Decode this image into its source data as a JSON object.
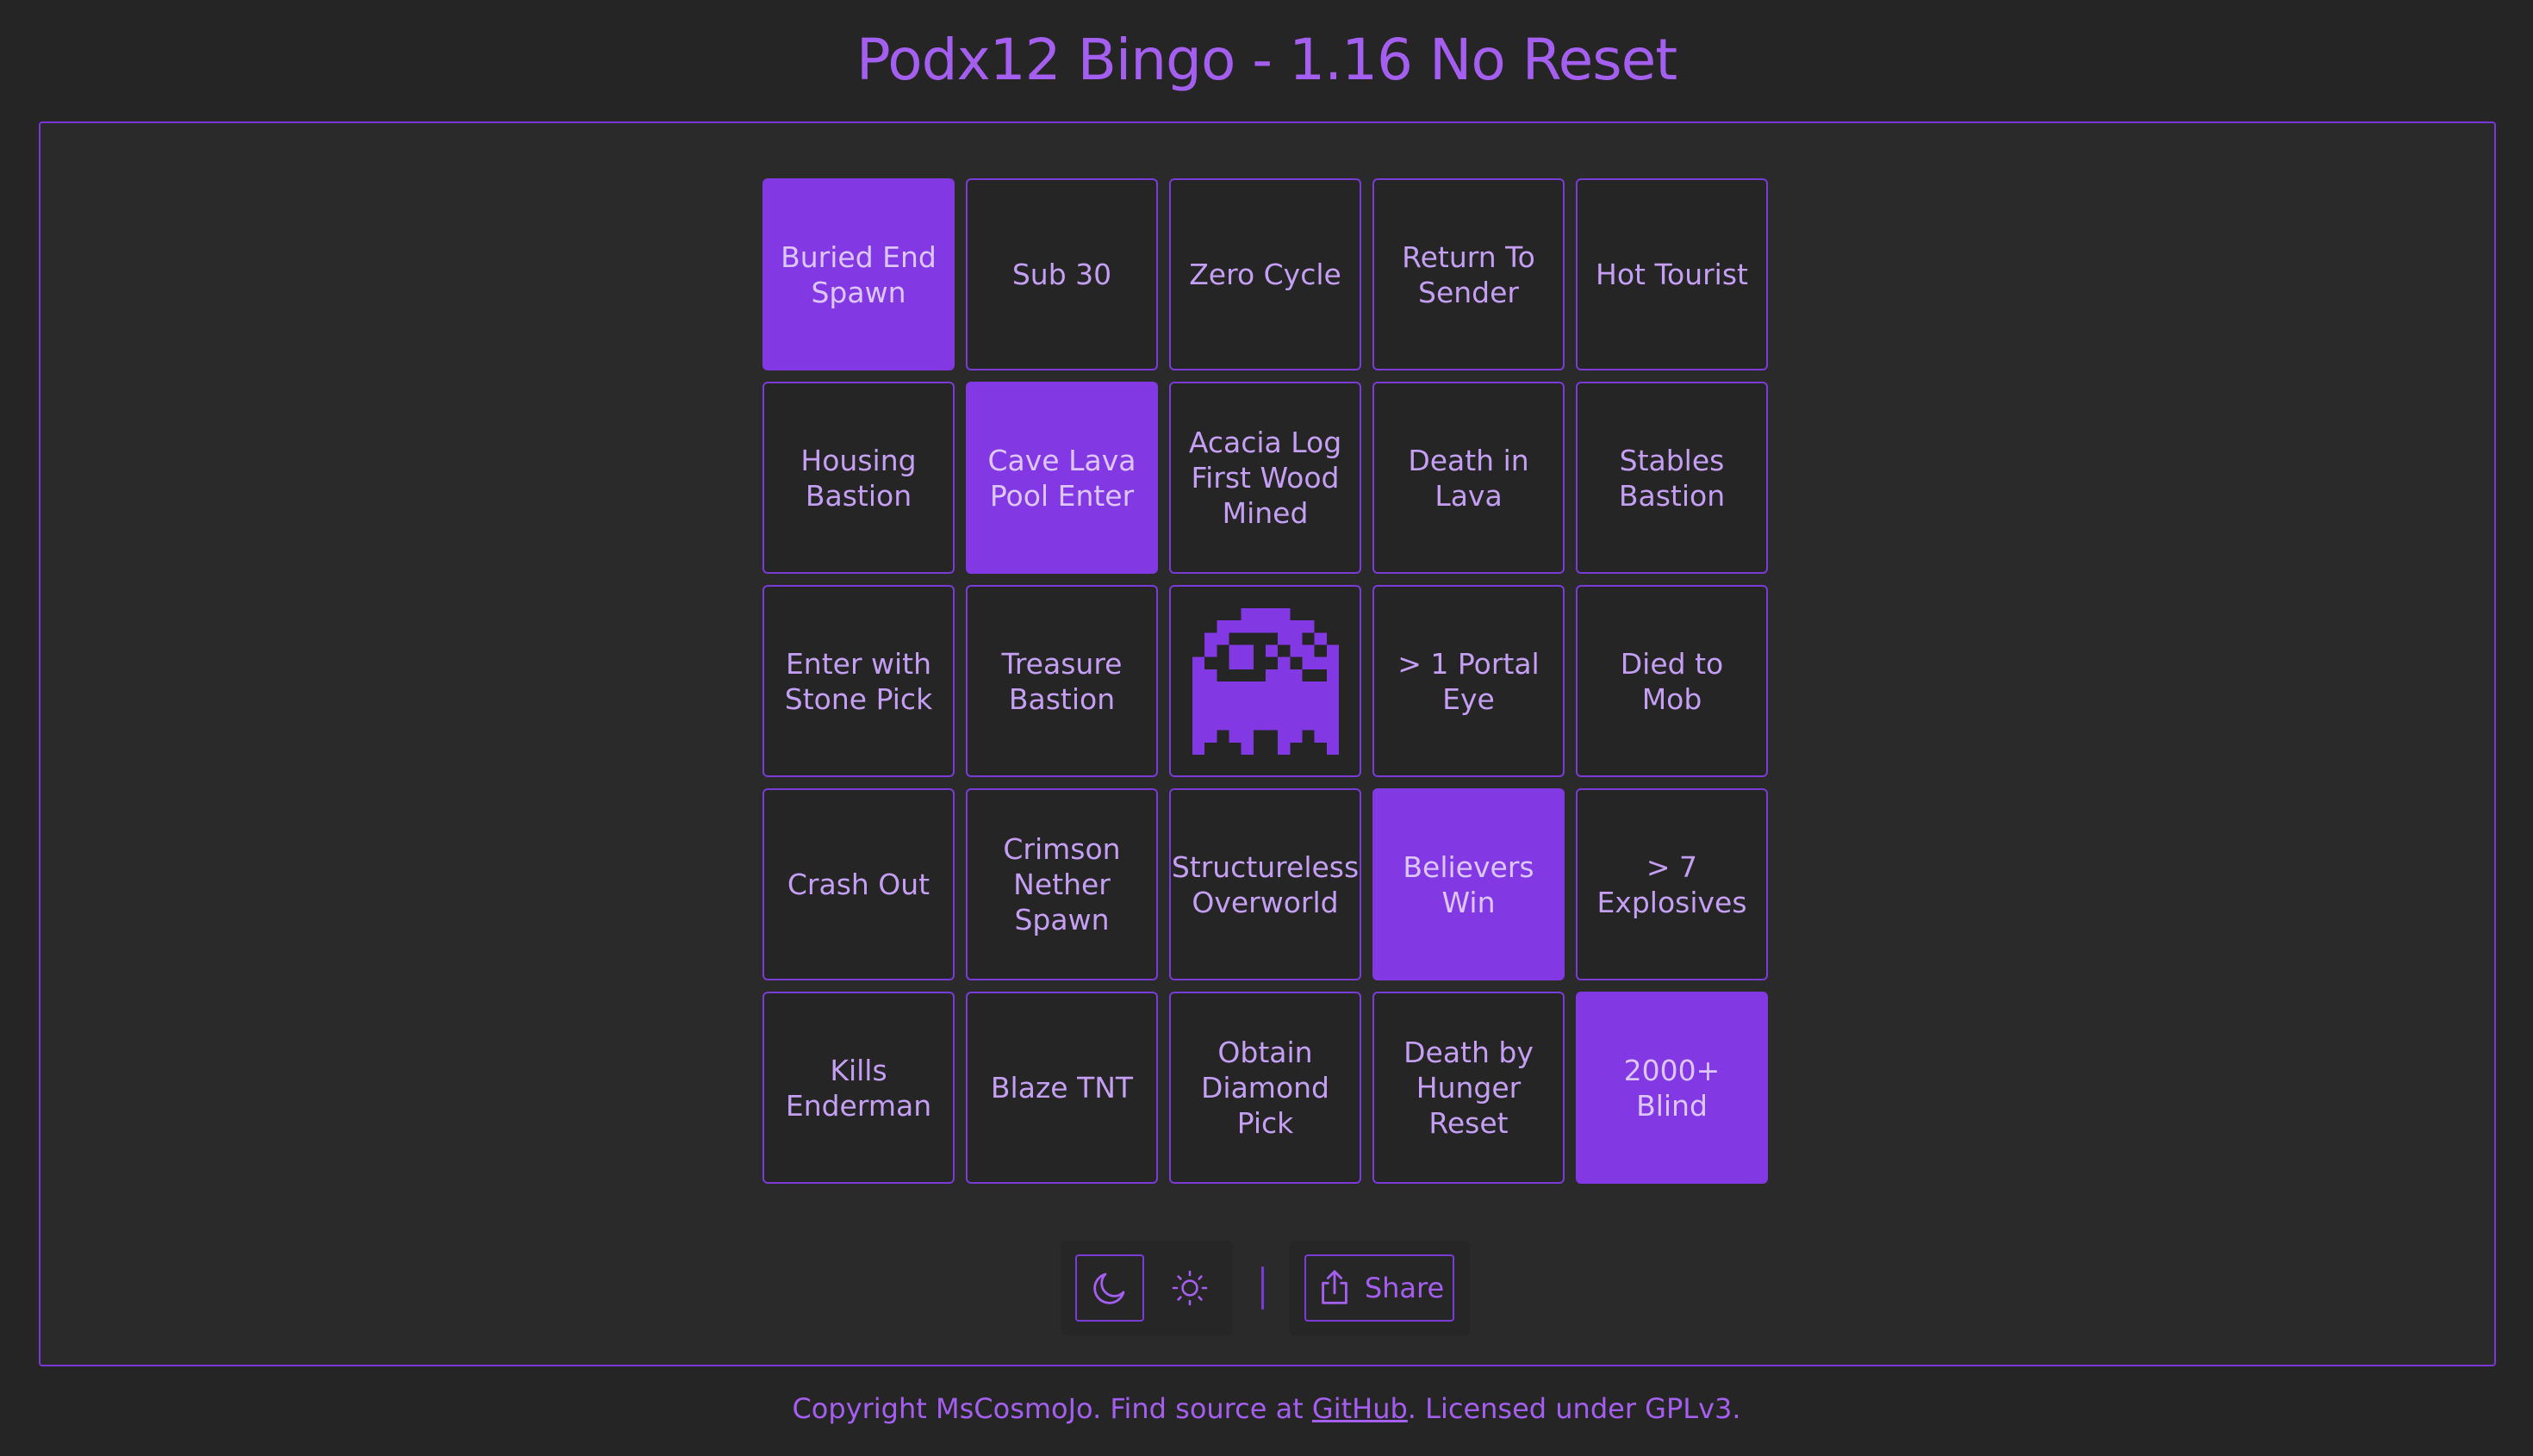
{
  "header": {
    "title": "Podx12 Bingo - 1.16 No Reset"
  },
  "board": {
    "cells": [
      {
        "label": "Buried End Spawn",
        "marked": true
      },
      {
        "label": "Sub 30",
        "marked": false
      },
      {
        "label": "Zero Cycle",
        "marked": false
      },
      {
        "label": "Return To Sender",
        "marked": false
      },
      {
        "label": "Hot Tourist",
        "marked": false
      },
      {
        "label": "Housing Bastion",
        "marked": false
      },
      {
        "label": "Cave Lava Pool Enter",
        "marked": true
      },
      {
        "label": "Acacia Log First Wood Mined",
        "marked": false
      },
      {
        "label": "Death in Lava",
        "marked": false
      },
      {
        "label": "Stables Bastion",
        "marked": false
      },
      {
        "label": "Enter with Stone Pick",
        "marked": false
      },
      {
        "label": "Treasure Bastion",
        "marked": false
      },
      {
        "label": "",
        "marked": false,
        "icon": "ghost-icon"
      },
      {
        "label": "> 1 Portal Eye",
        "marked": false
      },
      {
        "label": "Died to Mob",
        "marked": false
      },
      {
        "label": "Crash Out",
        "marked": false
      },
      {
        "label": "Crimson Nether Spawn",
        "marked": false
      },
      {
        "label": "Structureless Overworld",
        "marked": false
      },
      {
        "label": "Believers Win",
        "marked": true
      },
      {
        "label": "> 7 Explosives",
        "marked": false
      },
      {
        "label": "Kills Enderman",
        "marked": false
      },
      {
        "label": "Blaze TNT",
        "marked": false
      },
      {
        "label": "Obtain Diamond Pick",
        "marked": false
      },
      {
        "label": "Death by Hunger Reset",
        "marked": false
      },
      {
        "label": "2000+ Blind",
        "marked": true
      }
    ]
  },
  "toolbar": {
    "dark_icon": "moon-icon",
    "light_icon": "sun-icon",
    "share_icon": "share-icon",
    "share_label": "Share"
  },
  "footer": {
    "prefix": "Copyright MsCosmoJo. Find source at ",
    "link_text": "GitHub",
    "suffix": ". Licensed under GPLv3."
  },
  "colors": {
    "accent": "#8238e2",
    "text_accent": "#a45ff0",
    "cell_text": "#c49ff4",
    "background": "#252525"
  }
}
